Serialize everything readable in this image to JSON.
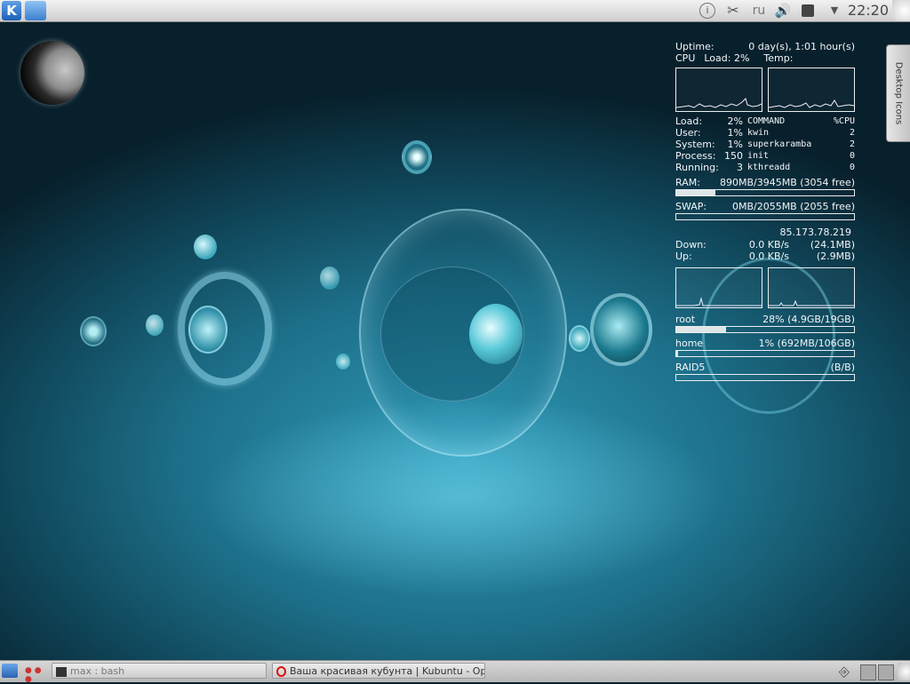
{
  "top_panel": {
    "kmenu_icon": "kde-logo-icon",
    "folder_icon": "folder-icon",
    "tray": {
      "info_icon": "info-icon",
      "scissors_icon": "scissors-icon",
      "keyboard_layout": "ru",
      "volume_icon": "volume-icon",
      "network_icon": "network-icon",
      "expand_icon": "chevron-down-icon"
    },
    "clock": "22:20"
  },
  "desktop_tab": {
    "label": "Desktop Icons"
  },
  "sysmon": {
    "uptime_label": "Uptime:",
    "uptime_value": "0 day(s), 1:01 hour(s)",
    "cpu_label": "CPU",
    "cpu_load": "Load: 2%",
    "temp_label": "Temp:",
    "stats": [
      {
        "label": "Load:",
        "value": "2%"
      },
      {
        "label": "User:",
        "value": "1%"
      },
      {
        "label": "System:",
        "value": "1%"
      },
      {
        "label": "Process:",
        "value": "150"
      },
      {
        "label": "Running:",
        "value": "3"
      }
    ],
    "process_headers": {
      "command": "COMMAND",
      "cpu": "%CPU"
    },
    "processes": [
      {
        "command": "kwin",
        "cpu": "2"
      },
      {
        "command": "superkaramba",
        "cpu": "2"
      },
      {
        "command": "init",
        "cpu": "0"
      },
      {
        "command": "kthreadd",
        "cpu": "0"
      }
    ],
    "ram_label": "RAM:",
    "ram_value": "890MB/3945MB (3054 free)",
    "ram_fraction": 0.22,
    "swap_label": "SWAP:",
    "swap_value": "0MB/2055MB (2055 free)",
    "swap_fraction": 0.0,
    "ip": "85.173.78.219",
    "down_label": "Down:",
    "down_rate": "0.0 KB/s",
    "down_total": "(24.1MB)",
    "up_label": "Up:",
    "up_rate": "0.0 KB/s",
    "up_total": "(2.9MB)",
    "disks": [
      {
        "label": "root",
        "value": "28% (4.9GB/19GB)",
        "fraction": 0.28
      },
      {
        "label": "home",
        "value": "1% (692MB/106GB)",
        "fraction": 0.01
      },
      {
        "label": "RAID5",
        "value": "(B/B)",
        "fraction": 0.0
      }
    ]
  },
  "taskbar": {
    "show_desktop_icon": "show-desktop-icon",
    "pager_icon": "pager-icon",
    "tasks": [
      {
        "label": "max : bash",
        "icon": "terminal-icon"
      },
      {
        "label": "Ваша красивая кубунта | Kubuntu - Opera",
        "icon": "opera-icon"
      }
    ],
    "tray_icons": [
      "usb-icon",
      "tiles-icon",
      "tiles-icon-2",
      "cashew-icon"
    ]
  }
}
